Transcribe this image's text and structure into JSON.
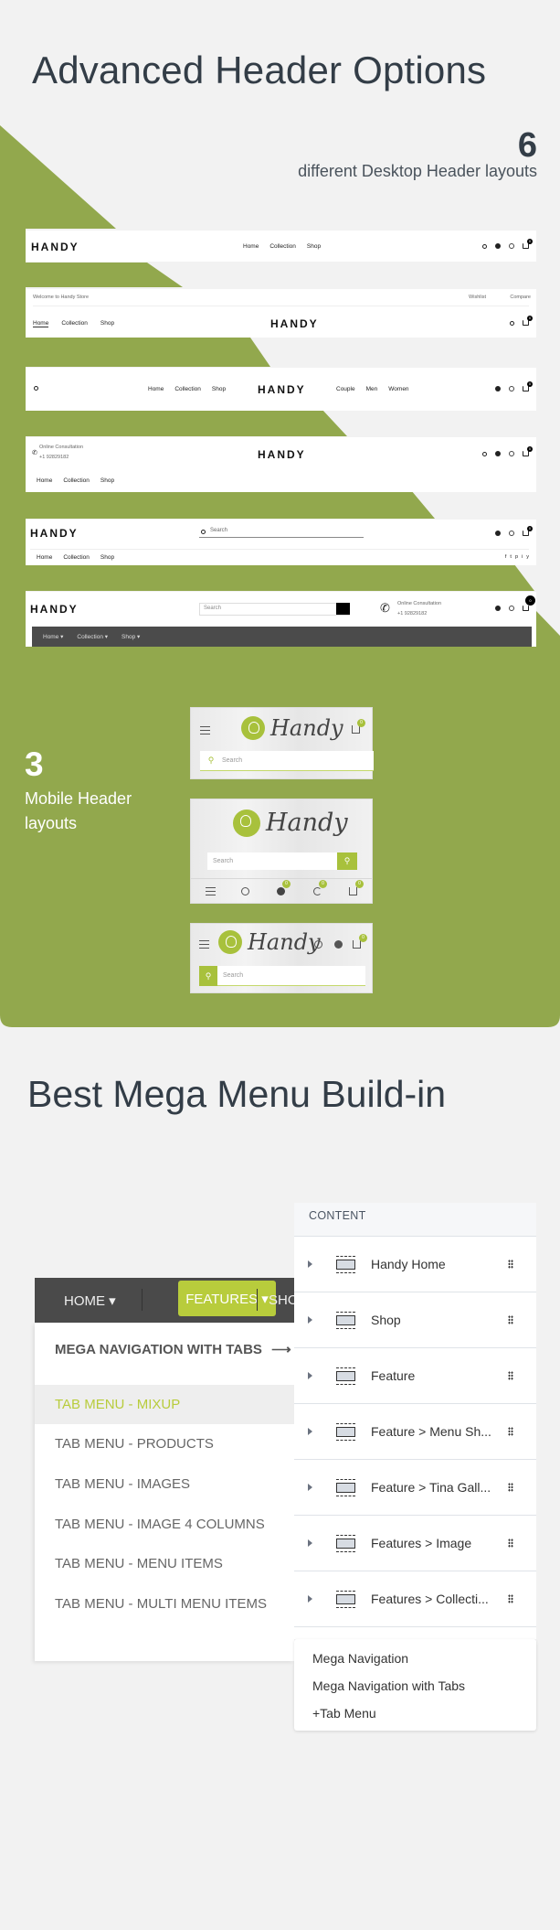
{
  "section1": {
    "title": "Advanced Header Options",
    "desktop_count": "6",
    "desktop_label": "different Desktop Header layouts",
    "accent_color": "#92a84d"
  },
  "desktop_headers": [
    {
      "logo": "HANDY",
      "nav": [
        "Home",
        "Collection",
        "Shop"
      ],
      "icons": [
        "search-icon",
        "user-icon",
        "globe-icon",
        "cart-icon"
      ],
      "cart_count": "0"
    },
    {
      "topbar_text": "Welcome to Handy Store",
      "wishlist": "Wishlist",
      "compare": "Compare",
      "nav": [
        "Home",
        "Collection",
        "Shop"
      ],
      "logo": "HANDY",
      "cart_count": "0"
    },
    {
      "nav_left": [
        "Home",
        "Collection",
        "Shop"
      ],
      "logo": "HANDY",
      "nav_right": [
        "Couple",
        "Men",
        "Women"
      ],
      "cart_count": "0"
    },
    {
      "consult_label": "Online Consultation",
      "phone": "+1 92829182",
      "logo": "HANDY",
      "nav": [
        "Home",
        "Collection",
        "Shop"
      ],
      "cart_count": "0"
    },
    {
      "logo": "HANDY",
      "search_placeholder": "Search",
      "nav": [
        "Home",
        "Collection",
        "Shop"
      ],
      "social": [
        "f",
        "t",
        "p",
        "i",
        "y"
      ],
      "cart_count": "0"
    },
    {
      "logo": "HANDY",
      "search_placeholder": "Search",
      "consult_label": "Online Consultation",
      "phone": "+1 92829182",
      "nav": [
        "Home ▾",
        "Collection ▾",
        "Shop ▾"
      ],
      "cart_count": "0"
    }
  ],
  "mobile": {
    "count": "3",
    "label": "Mobile Header layouts",
    "brand": "Handy",
    "search_placeholder": "Search",
    "badge_count": "0",
    "brand_color": "#a8c13c"
  },
  "section2": {
    "title": "Best Mega Menu Build-in"
  },
  "mega_menu": {
    "nav": [
      "HOME ▾",
      "FEATURES ▾",
      "SHO"
    ],
    "title": "MEGA NAVIGATION WITH TABS",
    "title_arrow": "⟶",
    "items": [
      {
        "label": "TAB MENU - MIXUP",
        "active": true
      },
      {
        "label": "TAB MENU - PRODUCTS",
        "active": false
      },
      {
        "label": "TAB MENU - IMAGES",
        "active": false
      },
      {
        "label": "TAB MENU - IMAGE 4 COLUMNS",
        "active": false
      },
      {
        "label": "TAB MENU - MENU ITEMS",
        "active": false
      },
      {
        "label": "TAB MENU - MULTI MENU ITEMS",
        "active": false
      }
    ]
  },
  "content_panel": {
    "header": "CONTENT",
    "rows": [
      "Handy Home",
      "Shop",
      "Feature",
      "Feature > Menu Sh...",
      "Feature > Tina Gall...",
      "Features > Image",
      "Features > Collecti..."
    ],
    "popup_items": [
      "Mega Navigation",
      "Mega Navigation with Tabs",
      "+Tab Menu"
    ]
  }
}
